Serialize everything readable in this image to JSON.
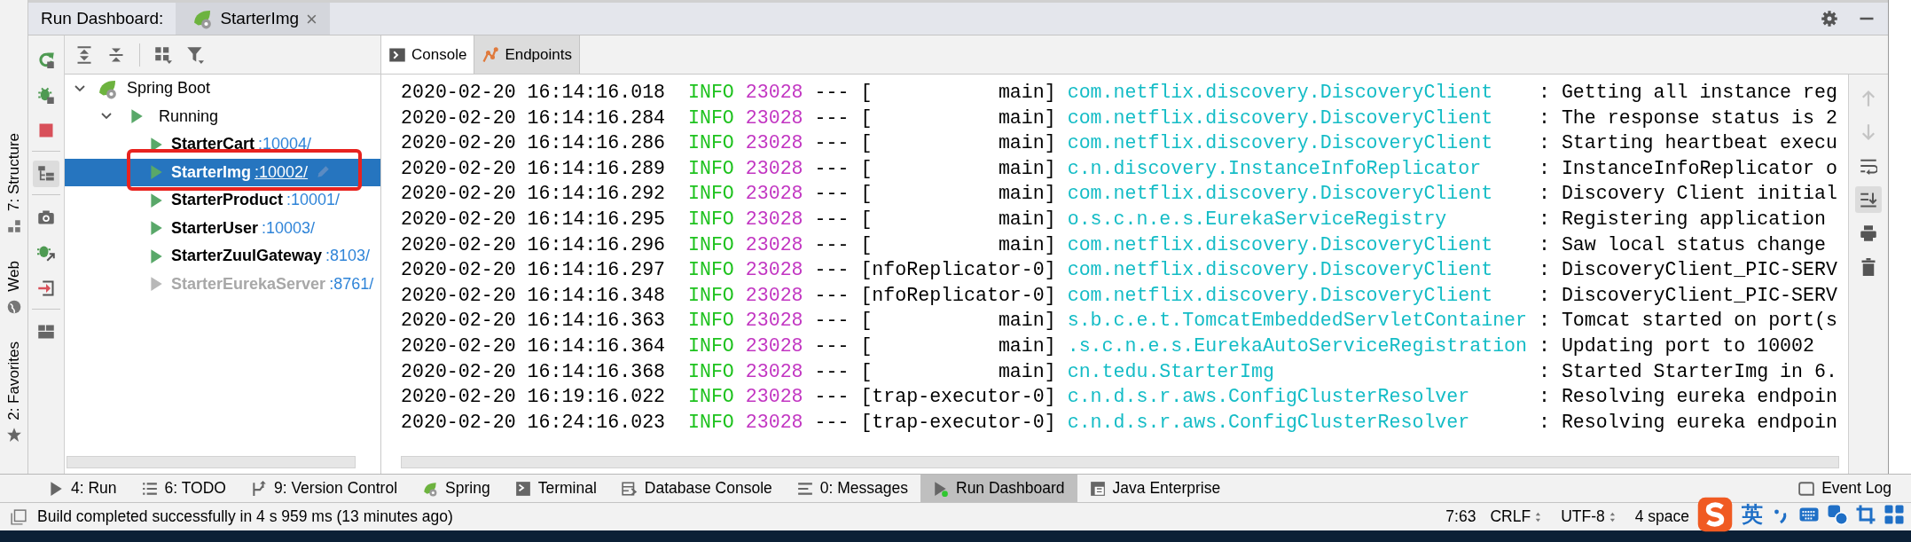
{
  "side_strip": [
    {
      "label": "7: Structure",
      "kind": "structure"
    },
    {
      "label": "Web",
      "kind": "globe"
    },
    {
      "label": "2: Favorites",
      "kind": "star"
    }
  ],
  "header": {
    "title": "Run Dashboard:",
    "tab": {
      "label": "StarterImg",
      "close": "×"
    }
  },
  "left_tools": [
    [
      {
        "kind": "rerun",
        "on": false
      },
      {
        "kind": "debug",
        "on": false
      },
      {
        "kind": "stop",
        "on": false
      }
    ],
    [
      {
        "kind": "tree",
        "on": true
      }
    ],
    [
      {
        "kind": "camera",
        "on": false
      },
      {
        "kind": "attach",
        "on": false
      },
      {
        "kind": "login",
        "on": false
      }
    ],
    [
      {
        "kind": "layout",
        "on": false
      }
    ]
  ],
  "tree": [
    {
      "kind": "group",
      "label": "Spring Boot",
      "expanded": true,
      "selected": false,
      "children": [
        {
          "kind": "status",
          "label": "Running",
          "expanded": true,
          "selected": false,
          "children": [
            {
              "kind": "app",
              "name": "StarterCart",
              "port": ":10004/",
              "running": true,
              "selected": false,
              "highlighted": false
            },
            {
              "kind": "app",
              "name": "StarterImg",
              "port": ":10002/",
              "running": true,
              "selected": true,
              "highlighted": true
            },
            {
              "kind": "app",
              "name": "StarterProduct",
              "port": ":10001/",
              "running": true,
              "selected": false,
              "highlighted": false
            },
            {
              "kind": "app",
              "name": "StarterUser",
              "port": ":10003/",
              "running": true,
              "selected": false,
              "highlighted": false
            },
            {
              "kind": "app",
              "name": "StarterZuulGateway",
              "port": ":8103/",
              "running": true,
              "selected": false,
              "highlighted": false
            },
            {
              "kind": "app",
              "name": "StarterEurekaServer",
              "port": ":8761/",
              "running": false,
              "selected": false,
              "highlighted": false
            }
          ]
        }
      ]
    }
  ],
  "console": {
    "tabs": [
      {
        "label": "Console",
        "kind": "console",
        "selected": true
      },
      {
        "label": "Endpoints",
        "kind": "endpoints",
        "selected": false
      }
    ],
    "lines": [
      {
        "time": "2020-02-20 16:14:16.018",
        "level": "INFO",
        "pid": "23028",
        "sep": "---",
        "thread": "[           main]",
        "logger": "com.netflix.discovery.DiscoveryClient",
        "message": ": Getting all instance reg"
      },
      {
        "time": "2020-02-20 16:14:16.284",
        "level": "INFO",
        "pid": "23028",
        "sep": "---",
        "thread": "[           main]",
        "logger": "com.netflix.discovery.DiscoveryClient",
        "message": ": The response status is 2"
      },
      {
        "time": "2020-02-20 16:14:16.286",
        "level": "INFO",
        "pid": "23028",
        "sep": "---",
        "thread": "[           main]",
        "logger": "com.netflix.discovery.DiscoveryClient",
        "message": ": Starting heartbeat execu"
      },
      {
        "time": "2020-02-20 16:14:16.289",
        "level": "INFO",
        "pid": "23028",
        "sep": "---",
        "thread": "[           main]",
        "logger": "c.n.discovery.InstanceInfoReplicator",
        "message": ": InstanceInfoReplicator o"
      },
      {
        "time": "2020-02-20 16:14:16.292",
        "level": "INFO",
        "pid": "23028",
        "sep": "---",
        "thread": "[           main]",
        "logger": "com.netflix.discovery.DiscoveryClient",
        "message": ": Discovery Client initial"
      },
      {
        "time": "2020-02-20 16:14:16.295",
        "level": "INFO",
        "pid": "23028",
        "sep": "---",
        "thread": "[           main]",
        "logger": "o.s.c.n.e.s.EurekaServiceRegistry",
        "message": ": Registering application"
      },
      {
        "time": "2020-02-20 16:14:16.296",
        "level": "INFO",
        "pid": "23028",
        "sep": "---",
        "thread": "[           main]",
        "logger": "com.netflix.discovery.DiscoveryClient",
        "message": ": Saw local status change"
      },
      {
        "time": "2020-02-20 16:14:16.297",
        "level": "INFO",
        "pid": "23028",
        "sep": "---",
        "thread": "[nfoReplicator-0]",
        "logger": "com.netflix.discovery.DiscoveryClient",
        "message": ": DiscoveryClient_PIC-SERV"
      },
      {
        "time": "2020-02-20 16:14:16.348",
        "level": "INFO",
        "pid": "23028",
        "sep": "---",
        "thread": "[nfoReplicator-0]",
        "logger": "com.netflix.discovery.DiscoveryClient",
        "message": ": DiscoveryClient_PIC-SERV"
      },
      {
        "time": "2020-02-20 16:14:16.363",
        "level": "INFO",
        "pid": "23028",
        "sep": "---",
        "thread": "[           main]",
        "logger": "s.b.c.e.t.TomcatEmbeddedServletContainer",
        "message": ": Tomcat started on port(s"
      },
      {
        "time": "2020-02-20 16:14:16.364",
        "level": "INFO",
        "pid": "23028",
        "sep": "---",
        "thread": "[           main]",
        "logger": ".s.c.n.e.s.EurekaAutoServiceRegistration",
        "message": ": Updating port to 10002"
      },
      {
        "time": "2020-02-20 16:14:16.368",
        "level": "INFO",
        "pid": "23028",
        "sep": "---",
        "thread": "[           main]",
        "logger": "cn.tedu.StarterImg",
        "message": ": Started StarterImg in 6."
      },
      {
        "time": "2020-02-20 16:19:16.022",
        "level": "INFO",
        "pid": "23028",
        "sep": "---",
        "thread": "[trap-executor-0]",
        "logger": "c.n.d.s.r.aws.ConfigClusterResolver",
        "message": ": Resolving eureka endpoin"
      },
      {
        "time": "2020-02-20 16:24:16.023",
        "level": "INFO",
        "pid": "23028",
        "sep": "---",
        "thread": "[trap-executor-0]",
        "logger": "c.n.d.s.r.aws.ConfigClusterResolver",
        "message": ": Resolving eureka endpoin"
      }
    ],
    "tools": [
      {
        "kind": "up",
        "disabled": true,
        "on": false
      },
      {
        "kind": "down",
        "disabled": true,
        "on": false
      },
      {
        "kind": "wrap",
        "disabled": false,
        "on": false
      },
      {
        "kind": "scroll-end",
        "disabled": false,
        "on": true
      },
      {
        "kind": "print",
        "disabled": false,
        "on": false
      },
      {
        "kind": "trash",
        "disabled": false,
        "on": false
      }
    ]
  },
  "bottom_tabs": [
    {
      "label": "4: Run",
      "kind": "run",
      "selected": false
    },
    {
      "label": "6: TODO",
      "kind": "todo",
      "selected": false
    },
    {
      "label": "9: Version Control",
      "kind": "vcs",
      "selected": false
    },
    {
      "label": "Spring",
      "kind": "spring",
      "selected": false
    },
    {
      "label": "Terminal",
      "kind": "terminal",
      "selected": false
    },
    {
      "label": "Database Console",
      "kind": "database",
      "selected": false
    },
    {
      "label": "0: Messages",
      "kind": "messages",
      "selected": false
    },
    {
      "label": "Run Dashboard",
      "kind": "dashboard",
      "selected": true
    },
    {
      "label": "Java Enterprise",
      "kind": "javaee",
      "selected": false
    }
  ],
  "event_log": {
    "label": "Event Log"
  },
  "status_bar": {
    "message": "Build completed successfully in 4 s 959 ms (13 minutes ago)",
    "items": [
      {
        "label": "7:63",
        "dropdown": false
      },
      {
        "label": "CRLF",
        "dropdown": true
      },
      {
        "label": "UTF-8",
        "dropdown": true
      },
      {
        "label": "4 space",
        "dropdown": false
      }
    ]
  },
  "ime": {
    "mode": "英"
  }
}
